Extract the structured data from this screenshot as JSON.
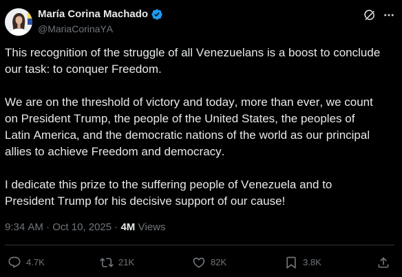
{
  "tweet": {
    "author": {
      "name": "María Corina Machado",
      "handle": "@MariaCorinaYA",
      "verified": true,
      "avatar": "profile-photo"
    },
    "header_actions": {
      "grok": {
        "icon": "grok-icon"
      },
      "more": {
        "icon": "more-icon"
      }
    },
    "body": {
      "paragraphs": [
        {
          "lines": [
            "This recognition of the struggle of all Venezuelans is a boost to conclude",
            "our task: to conquer Freedom."
          ]
        },
        {
          "lines": [
            "We are on the threshold of victory and today, more than ever, we count",
            "on President Trump, the people of the United States, the peoples of",
            "Latin America, and the democratic nations of the world as our principal",
            "allies to achieve Freedom and democracy."
          ]
        },
        {
          "lines": [
            "I dedicate this prize to the suffering people of Venezuela and to",
            "President Trump for his decisive support of our cause!"
          ]
        }
      ]
    },
    "meta": {
      "time": "9:34 AM",
      "separator": "·",
      "date": "Oct 10, 2025",
      "views_count": "4M",
      "views_label": "Views"
    },
    "actions": {
      "reply": {
        "icon": "reply-icon",
        "count": "4.7K"
      },
      "repost": {
        "icon": "repost-icon",
        "count": "21K"
      },
      "like": {
        "icon": "like-icon",
        "count": "82K"
      },
      "bookmark": {
        "icon": "bookmark-icon",
        "count": "3.8K"
      },
      "share": {
        "icon": "share-icon"
      }
    }
  },
  "colors": {
    "background": "#000000",
    "text": "#e7e9ea",
    "secondary": "#71767b",
    "verified": "#1d9bf0",
    "divider": "#2f3336"
  }
}
